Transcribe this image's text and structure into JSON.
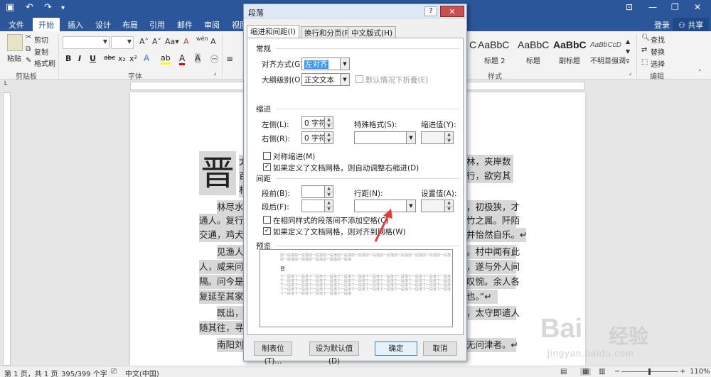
{
  "titlebar": {
    "undo": "↶",
    "redo": "↷",
    "customize": "▾",
    "ribbon_opts": "⊡",
    "minimize": "—",
    "restore": "❐",
    "close": "✕"
  },
  "tabs": [
    "文件",
    "开始",
    "插入",
    "设计",
    "布局",
    "引用",
    "邮件",
    "审阅",
    "视图"
  ],
  "account": {
    "login": "登录",
    "share": "共享"
  },
  "ribbon": {
    "paste": "粘贴",
    "cut": "剪切",
    "copy": "复制",
    "format_painter": "格式刷",
    "clipboard_group": "剪贴板",
    "font_group": "字体",
    "style_group": "样式",
    "edit_group": "编辑",
    "find": "查找",
    "replace": "替换",
    "select": "选择",
    "font_buttons": [
      "B",
      "I",
      "U",
      "abc",
      "x₂",
      "x²"
    ],
    "styles": [
      {
        "preview": "AaBbC",
        "name": "标题 2"
      },
      {
        "preview": "AaBbC",
        "name": "标题"
      },
      {
        "preview": "AaBbC",
        "name": "副标题"
      },
      {
        "preview": "AaBbCcD",
        "name": "不明显强调"
      }
    ]
  },
  "document": {
    "dropcap": "晋",
    "lines": [
      {
        "text": "太",
        "right": "林，夹岸数"
      },
      {
        "text": "百",
        "right": "行，欲穷其"
      },
      {
        "text": "林",
        "right": ""
      },
      {
        "text": "林尽水",
        "right": "，初极狭，才"
      },
      {
        "text": "通人。复行",
        "right": "竹之属。阡陌"
      },
      {
        "text": "交通，鸡犬",
        "right": "并怡然自乐。↵"
      },
      {
        "text": "见渔人",
        "right": "。村中闻有此"
      },
      {
        "text": "人，咸来问",
        "right": "，遂与外人间"
      },
      {
        "text": "隔。问今是",
        "right": "叹惋。余人各"
      },
      {
        "text": "复延至其家",
        "right": "也。”↵"
      },
      {
        "text": "既出，",
        "right": "，太守即遣人"
      },
      {
        "text": "随其往，寻",
        "right": ""
      },
      {
        "text": "南阳刘",
        "right": "无问津者。↵"
      }
    ]
  },
  "status": {
    "page": "第 1 页，共 1 页",
    "words": "395/399 个字",
    "lang": "中文(中国)",
    "zoom": "110%",
    "zoom_minus": "−",
    "zoom_plus": "+"
  },
  "dialog": {
    "title": "段落",
    "help": "?",
    "close": "✕",
    "tabs": [
      "缩进和间距(I)",
      "换行和分页(P)",
      "中文版式(H)"
    ],
    "general": {
      "section": "常规",
      "align_label": "对齐方式(G):",
      "align_value": "左对齐",
      "outline_label": "大纲级别(O):",
      "outline_value": "正文文本",
      "collapse_label": "默认情况下折叠(E)"
    },
    "indent": {
      "section": "缩进",
      "left_label": "左侧(L):",
      "left_value": "0 字符",
      "right_label": "右侧(R):",
      "right_value": "0 字符",
      "special_label": "特殊格式(S):",
      "special_value": "",
      "by_label": "缩进值(Y):",
      "by_value": "",
      "mirror_label": "对称缩进(M)",
      "auto_label": "如果定义了文档网格，则自动调整右缩进(D)"
    },
    "spacing": {
      "section": "间距",
      "before_label": "段前(B):",
      "before_value": "",
      "after_label": "段后(F):",
      "after_value": "",
      "line_label": "行距(N):",
      "line_value": "",
      "at_label": "设置值(A):",
      "at_value": "",
      "nospace_label": "在相同样式的段落间不添加空格(C)",
      "snap_label": "如果定义了文档网格，则对齐到网格(W)"
    },
    "preview_section": "预览",
    "preview_lines": [
      "前一段落前一段落前一段落前一段落前一段落前一段落前一段落前一段落前一段落前一段落前一段落前一段落",
      "前一段落前一段落前一段落前一段落前一段落",
      "晋",
      "下一段落下一段落下一段落下一段落下一段落下一段落下一段落下一段落下一段落下一段落下一段落下一段落",
      "下一段落下一段落下一段落下一段落下一段落下一段落下一段落下一段落下一段落下一段落下一段落下一段落",
      "下一段落下一段落下一段落下一段落下一段落下一段落下一段落下一段落下一段落下一段落下一段落下一段落",
      "下一段落下一段落下一段落下一段落下一段落下一段落下一段落下一段落下一段落下一段落下一段落下一段落",
      "下一段落下一段落下一段落下一段落下一段落"
    ],
    "buttons": {
      "tabs": "制表位(T)...",
      "default": "设为默认值(D)",
      "ok": "确定",
      "cancel": "取消"
    },
    "check_mark": "✓"
  },
  "watermark": {
    "brand": "Bai",
    "brand2": "经验",
    "url": "jingyan.baidu.com"
  },
  "colors": {
    "accent": "#2b579a",
    "arrow": "#e53935"
  }
}
